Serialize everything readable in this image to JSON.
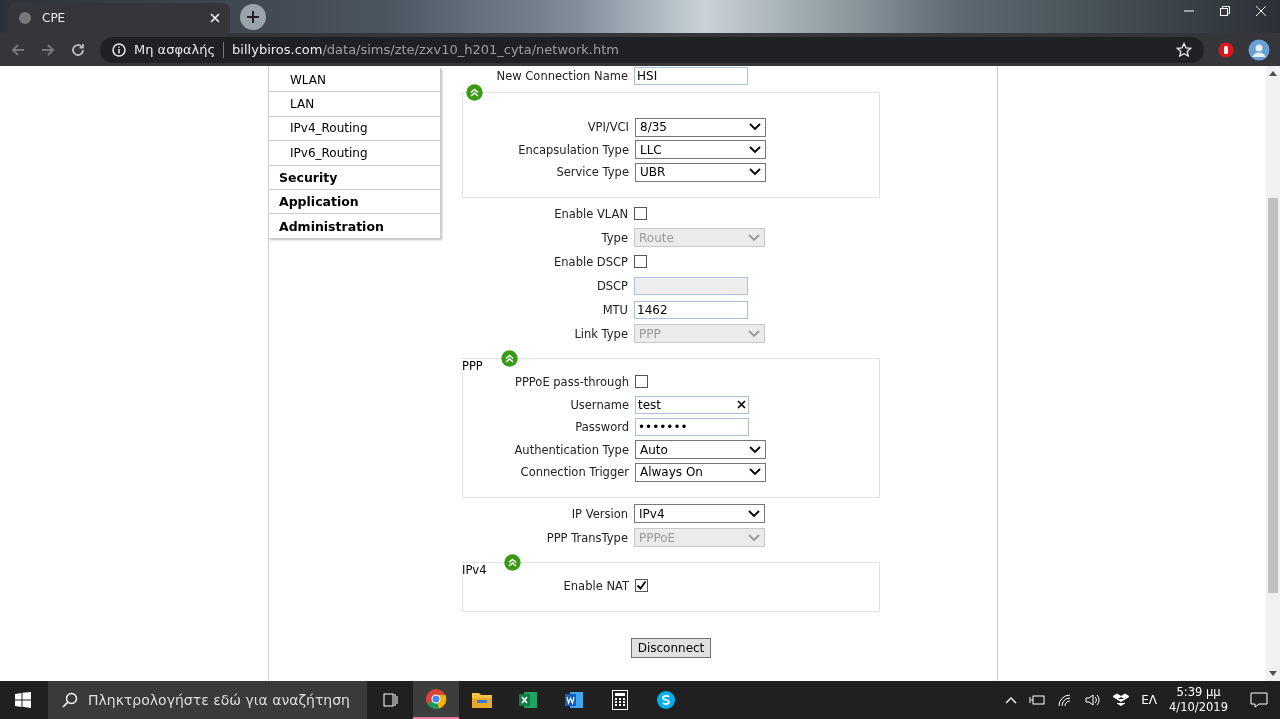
{
  "browser": {
    "tab_title": "CPE",
    "security_label": "Μη ασφαλής",
    "url_host": "billybiros.com",
    "url_path": "/data/sims/zte/zxv10_h201_cyta/network.htm"
  },
  "sidebar": {
    "items": [
      {
        "label": "WLAN",
        "kind": "sub"
      },
      {
        "label": "LAN",
        "kind": "sub"
      },
      {
        "label": "IPv4_Routing",
        "kind": "sub"
      },
      {
        "label": "IPv6_Routing",
        "kind": "sub"
      },
      {
        "label": "Security",
        "kind": "main"
      },
      {
        "label": "Application",
        "kind": "main"
      },
      {
        "label": "Administration",
        "kind": "main"
      }
    ]
  },
  "form": {
    "top_field": {
      "label": "New Connection Name",
      "value": "HSI"
    },
    "sections": [
      {
        "boxed": true,
        "collapsible": true,
        "rows": [
          {
            "kind": "select",
            "label": "VPI/VCI",
            "value": "8/35",
            "disabled": false
          },
          {
            "kind": "select",
            "label": "Encapsulation Type",
            "value": "LLC",
            "disabled": false
          },
          {
            "kind": "select",
            "label": "Service Type",
            "value": "UBR",
            "disabled": false
          }
        ]
      },
      {
        "boxed": false,
        "collapsible": false,
        "rows": [
          {
            "kind": "checkbox",
            "label": "Enable VLAN",
            "checked": false
          },
          {
            "kind": "select",
            "label": "Type",
            "value": "Route",
            "disabled": true
          },
          {
            "kind": "checkbox",
            "label": "Enable DSCP",
            "checked": false
          },
          {
            "kind": "text",
            "label": "DSCP",
            "value": "",
            "disabled": true
          },
          {
            "kind": "text",
            "label": "MTU",
            "value": "1462",
            "disabled": false
          },
          {
            "kind": "select",
            "label": "Link Type",
            "value": "PPP",
            "disabled": true
          }
        ]
      },
      {
        "boxed": true,
        "collapsible": true,
        "legend": "PPP",
        "rows": [
          {
            "kind": "checkbox",
            "label": "PPPoE pass-through",
            "checked": false
          },
          {
            "kind": "text",
            "label": "Username",
            "value": "test",
            "disabled": false,
            "clearable": true
          },
          {
            "kind": "text",
            "label": "Password",
            "value": "•••••••",
            "disabled": false
          },
          {
            "kind": "select",
            "label": "Authentication Type",
            "value": "Auto",
            "disabled": false
          },
          {
            "kind": "select",
            "label": "Connection Trigger",
            "value": "Always On",
            "disabled": false
          }
        ]
      },
      {
        "boxed": false,
        "collapsible": false,
        "rows": [
          {
            "kind": "select",
            "label": "IP Version",
            "value": "IPv4",
            "disabled": false
          },
          {
            "kind": "select",
            "label": "PPP TransType",
            "value": "PPPoE",
            "disabled": true
          }
        ]
      },
      {
        "boxed": true,
        "collapsible": true,
        "legend": "IPv4",
        "rows": [
          {
            "kind": "checkbox",
            "label": "Enable NAT",
            "checked": true
          }
        ]
      }
    ],
    "button": "Disconnect"
  },
  "taskbar": {
    "search_placeholder": "Πληκτρολογήστε εδώ για αναζήτηση",
    "language": "ΕΛ",
    "time": "5:39 μμ",
    "date": "4/10/2019"
  }
}
